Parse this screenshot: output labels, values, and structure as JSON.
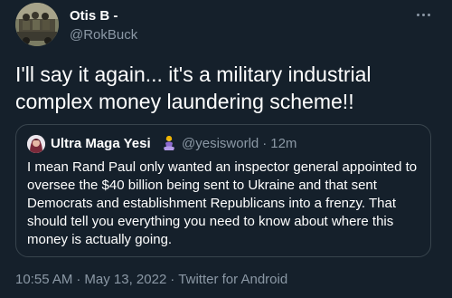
{
  "author": {
    "name": "Otis B -",
    "handle": "@RokBuck"
  },
  "tweet": {
    "text": "I'll say it again... it's a military industrial complex money laundering scheme!!"
  },
  "quoted": {
    "name": "Ultra Maga Yesi",
    "handle": "@yesisworld",
    "separator": "·",
    "time": "12m",
    "text": "I mean Rand Paul only wanted an inspector general appointed to oversee the $40 billion being sent to Ukraine and that sent Democrats and establishment Republicans into a frenzy. That should tell you everything you need to know about where this money is actually going."
  },
  "meta": {
    "time": "10:55 AM",
    "separator": "·",
    "date": "May 13, 2022",
    "source": "Twitter for Android"
  },
  "icons": {
    "more": "more-options-icon",
    "emoji": "woman-in-lotus-position-emoji"
  },
  "colors": {
    "background": "#15202b",
    "text": "#ffffff",
    "secondary": "#8b98a5",
    "border": "#38444d"
  }
}
